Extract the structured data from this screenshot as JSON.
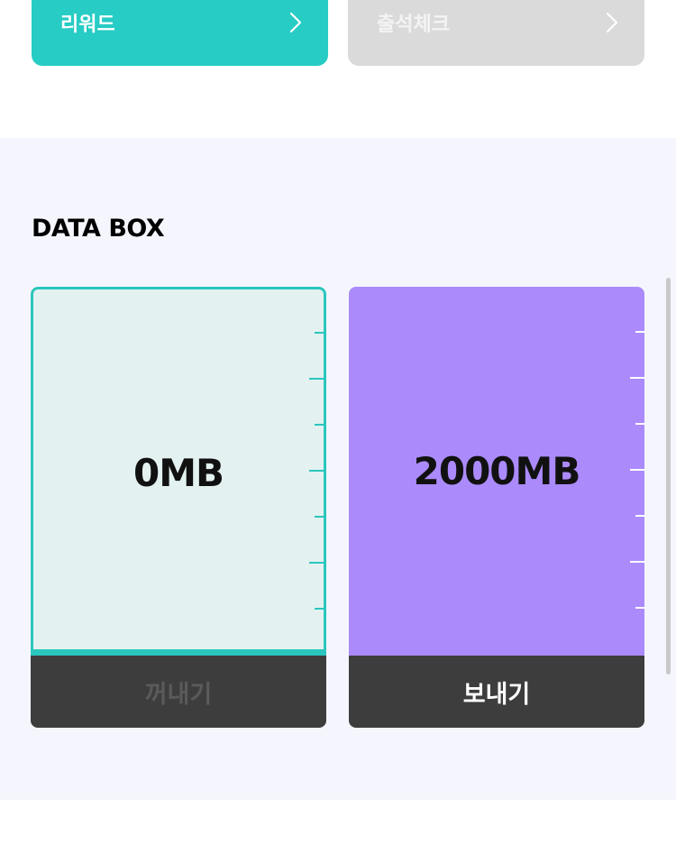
{
  "top_buttons": {
    "reward_label": "리워드",
    "attendance_label": "출석체크"
  },
  "data_box": {
    "title": "DATA BOX",
    "my_box": {
      "amount": "0MB",
      "fill_fraction": 0.0,
      "button_label": "꺼내기"
    },
    "shared_box": {
      "amount": "2000MB",
      "fill_fraction": 1.0,
      "button_label": "보내기"
    }
  },
  "colors": {
    "accent_teal": "#27ccc4",
    "disabled_gray": "#dadada",
    "purple": "#ab8afc",
    "dark_button": "#3d3d3d",
    "section_bg": "#f5f6fd"
  },
  "icons": [
    "chevron-right-icon"
  ]
}
